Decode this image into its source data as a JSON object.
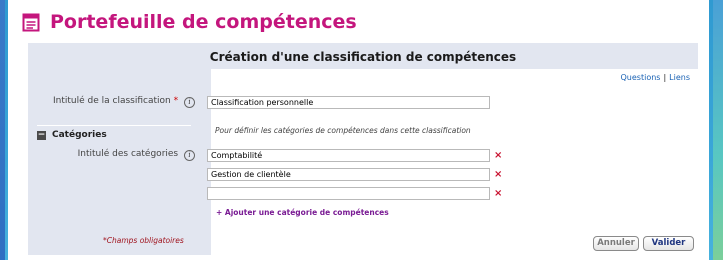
{
  "page": {
    "title": "Portefeuille de compétences",
    "title_icon": "notepad-icon",
    "brand_color": "#c4167d"
  },
  "panel": {
    "heading": "Création d'une classification de compétences",
    "links": {
      "questions": "Questions",
      "separator": "|",
      "liens": "Liens"
    }
  },
  "form": {
    "classification_label": "Intitulé de la classification",
    "required_mark": "*",
    "info_glyph": "i",
    "classification_value": "Classification personnelle",
    "categories_section": "Catégories",
    "categories_label": "Intitulé des catégories",
    "categories_hint": "Pour définir les catégories de compétences dans cette classification",
    "categories": [
      "Comptabilité",
      "Gestion de clientèle",
      ""
    ],
    "remove_glyph": "×",
    "add_category_link": "+ Ajouter une catégorie de compétences"
  },
  "footer": {
    "required_note": "*Champs obligatoires",
    "cancel_label": "Annuler",
    "submit_label": "Valider"
  }
}
